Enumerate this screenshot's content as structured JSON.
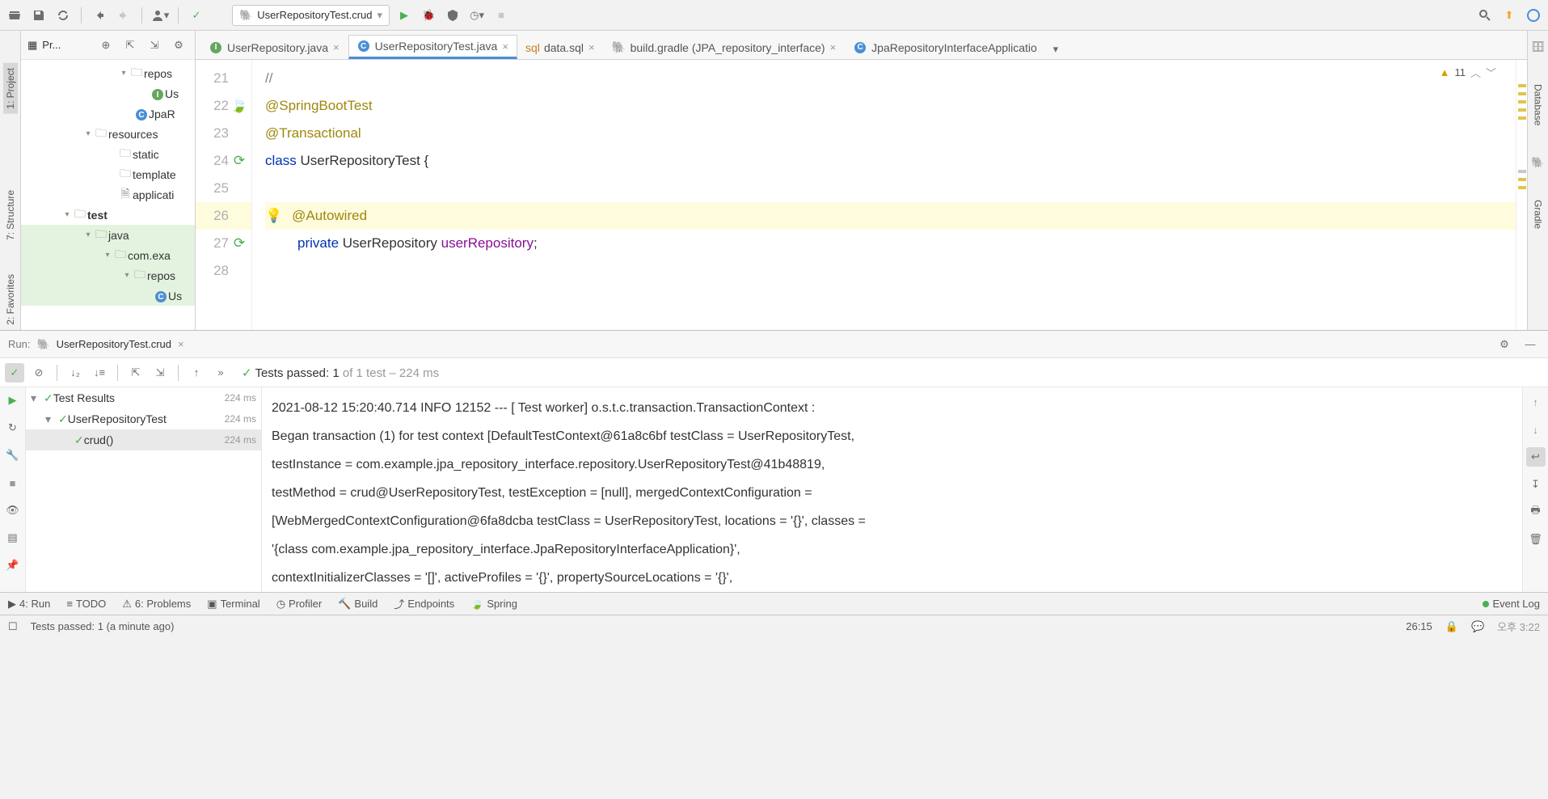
{
  "toolbar": {
    "run_config": "UserRepositoryTest.crud"
  },
  "project_panel": {
    "title": "Pr...",
    "tree": {
      "n0": "repos",
      "n1": "Us",
      "n2": "JpaR",
      "n3": "resources",
      "n4": "static",
      "n5": "template",
      "n6": "applicati",
      "n7": "test",
      "n8": "java",
      "n9": "com.exa",
      "n10": "repos",
      "n11": "Us"
    }
  },
  "tabs": {
    "t0": "UserRepository.java",
    "t1": "UserRepositoryTest.java",
    "t2": "data.sql",
    "t3": "build.gradle (JPA_repository_interface)",
    "t4": "JpaRepositoryInterfaceApplicatio"
  },
  "editor": {
    "lines": {
      "l21": "21",
      "l22": "22",
      "l23": "23",
      "l24": "24",
      "l25": "25",
      "l26": "26",
      "l27": "27",
      "l28": "28"
    },
    "code": {
      "c21": "//",
      "c22": "@SpringBootTest",
      "c23": "@Transactional",
      "c24_kw": "class ",
      "c24_name": "UserRepositoryTest {",
      "c26": "@Autowired",
      "c27_kw": "private ",
      "c27_type": "UserRepository ",
      "c27_field": "userRepository",
      "c27_semi": ";"
    },
    "warnings": "11"
  },
  "run_panel": {
    "label": "Run:",
    "config": "UserRepositoryTest.crud",
    "results_summary_prefix": "Tests passed: 1",
    "results_summary_suffix": " of 1 test – 224 ms",
    "tree": {
      "root": "Test Results",
      "root_time": "224 ms",
      "class": "UserRepositoryTest",
      "class_time": "224 ms",
      "method": "crud()",
      "method_time": "224 ms"
    },
    "console_lines": [
      "2021-08-12 15:20:40.714  INFO 12152 --- [    Test worker] o.s.t.c.transaction.TransactionContext   :",
      "Began transaction (1) for test context [DefaultTestContext@61a8c6bf testClass = UserRepositoryTest,",
      "testInstance = com.example.jpa_repository_interface.repository.UserRepositoryTest@41b48819,",
      "testMethod = crud@UserRepositoryTest, testException = [null], mergedContextConfiguration =",
      "[WebMergedContextConfiguration@6fa8dcba testClass = UserRepositoryTest, locations = '{}', classes =",
      "'{class com.example.jpa_repository_interface.JpaRepositoryInterfaceApplication}',",
      "contextInitializerClasses = '[]', activeProfiles = '{}', propertySourceLocations = '{}',"
    ]
  },
  "tool_windows": {
    "run": "4: Run",
    "todo": "TODO",
    "problems": "6: Problems",
    "terminal": "Terminal",
    "profiler": "Profiler",
    "build": "Build",
    "endpoints": "Endpoints",
    "spring": "Spring",
    "event_log": "Event Log"
  },
  "status_bar": {
    "message": "Tests passed: 1 (a minute ago)",
    "position": "26:15",
    "time": "오후 3:22"
  },
  "side_tabs": {
    "project": "1: Project",
    "structure": "7: Structure",
    "favorites": "2: Favorites",
    "database": "Database",
    "gradle": "Gradle"
  }
}
